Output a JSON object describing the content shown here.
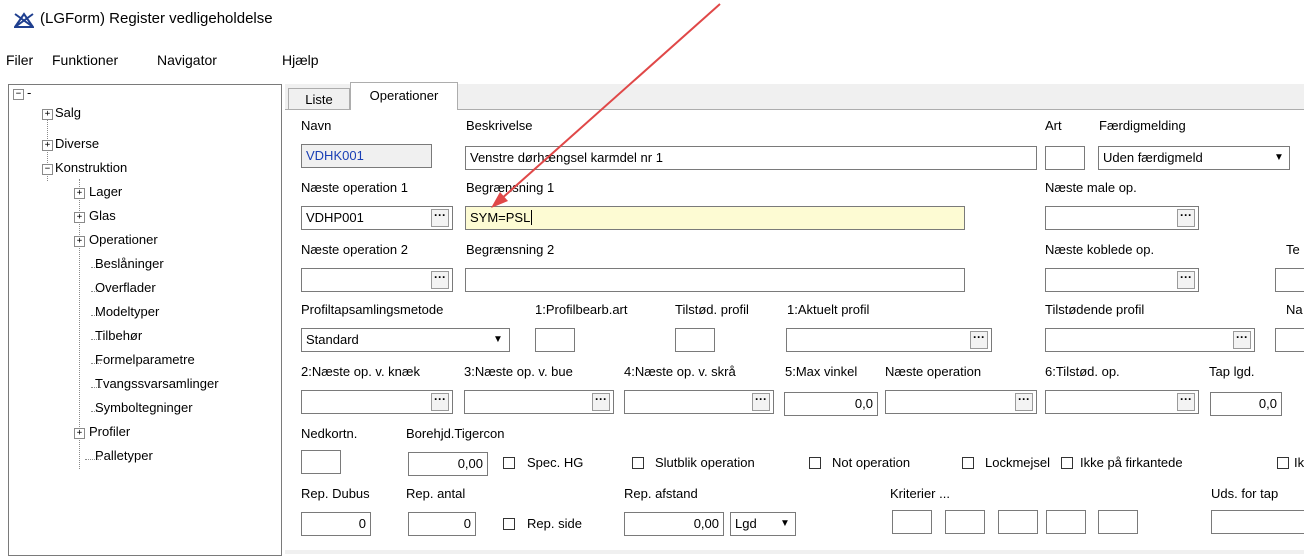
{
  "window": {
    "title": "(LGForm) Register vedligeholdelse"
  },
  "menu": [
    "Filer",
    "Funktioner",
    "Navigator",
    "Hjælp"
  ],
  "tree": {
    "root": "-",
    "items": [
      {
        "label": "Salg",
        "level": 1,
        "expander": "+"
      },
      {
        "label": "Diverse",
        "level": 1,
        "expander": "+"
      },
      {
        "label": "Konstruktion",
        "level": 1,
        "expander": "-"
      },
      {
        "label": "Lager",
        "level": 2,
        "expander": "+"
      },
      {
        "label": "Glas",
        "level": 2,
        "expander": "+"
      },
      {
        "label": "Operationer",
        "level": 2,
        "expander": "+"
      },
      {
        "label": "Beslåninger",
        "level": 2,
        "expander": ""
      },
      {
        "label": "Overflader",
        "level": 2,
        "expander": ""
      },
      {
        "label": "Modeltyper",
        "level": 2,
        "expander": ""
      },
      {
        "label": "Tilbehør",
        "level": 2,
        "expander": ""
      },
      {
        "label": "Formelparametre",
        "level": 2,
        "expander": ""
      },
      {
        "label": "Tvangssvarsamlinger",
        "level": 2,
        "expander": ""
      },
      {
        "label": "Symboltegninger",
        "level": 2,
        "expander": ""
      },
      {
        "label": "Profiler",
        "level": 2,
        "expander": "+"
      },
      {
        "label": "Palletyper",
        "level": 2,
        "expander": ""
      }
    ]
  },
  "tabs": {
    "liste": "Liste",
    "operationer": "Operationer"
  },
  "form": {
    "navn_label": "Navn",
    "navn_value": "VDHK001",
    "beskrivelse_label": "Beskrivelse",
    "beskrivelse_value": "Venstre dørhængsel karmdel nr 1",
    "art_label": "Art",
    "art_value": "",
    "faerdig_label": "Færdigmelding",
    "faerdig_value": "Uden færdigmeld",
    "naeste_op1_label": "Næste operation 1",
    "naeste_op1_value": "VDHP001",
    "begr1_label": "Begrænsning 1",
    "begr1_value": "SYM=PSL",
    "naeste_male_label": "Næste male op.",
    "naeste_op2_label": "Næste operation 2",
    "begr2_label": "Begrænsning 2",
    "naeste_koblede_label": "Næste koblede op.",
    "te_label": "Te",
    "profil_metode_label": "Profiltapsamlingsmetode",
    "profil_metode_value": "Standard",
    "profilbearb_label": "1:Profilbearb.art",
    "tilstod_profil_label": "Tilstød. profil",
    "aktuelt_profil_label": "1:Aktuelt profil",
    "tilstodende_profil_label": "Tilstødende profil",
    "na_label": "Na",
    "knaek_label": "2:Næste op. v. knæk",
    "bue_label": "3:Næste op. v. bue",
    "skra_label": "4:Næste op. v. skrå",
    "max_vinkel_label": "5:Max vinkel",
    "max_vinkel_value": "0,0",
    "naeste_operation_label": "Næste operation",
    "tilstod_op_label": "6:Tilstød. op.",
    "tap_lgd_label": "Tap lgd.",
    "tap_lgd_value": "0,0",
    "nedkortn_label": "Nedkortn.",
    "borehjd_label": "Borehjd.Tigercon",
    "borehjd_value": "0,00",
    "spec_hg": "Spec. HG",
    "slutblik": "Slutblik operation",
    "not_operation": "Not operation",
    "lockmejsel": "Lockmejsel",
    "ikke_firkant": "Ikke på firkantede",
    "ik": "Ik",
    "rep_dubus_label": "Rep. Dubus",
    "rep_dubus_value": "0",
    "rep_antal_label": "Rep. antal",
    "rep_antal_value": "0",
    "rep_side": "Rep. side",
    "rep_afstand_label": "Rep. afstand",
    "rep_afstand_value": "0,00",
    "lgd_value": "Lgd",
    "kriterier_label": "Kriterier ...",
    "uds_label": "Uds. for tap"
  },
  "colors": {
    "annotation_arrow": "#e04848",
    "readonly_text": "#1a3fb5",
    "highlight_field": "#fdfbd3"
  }
}
